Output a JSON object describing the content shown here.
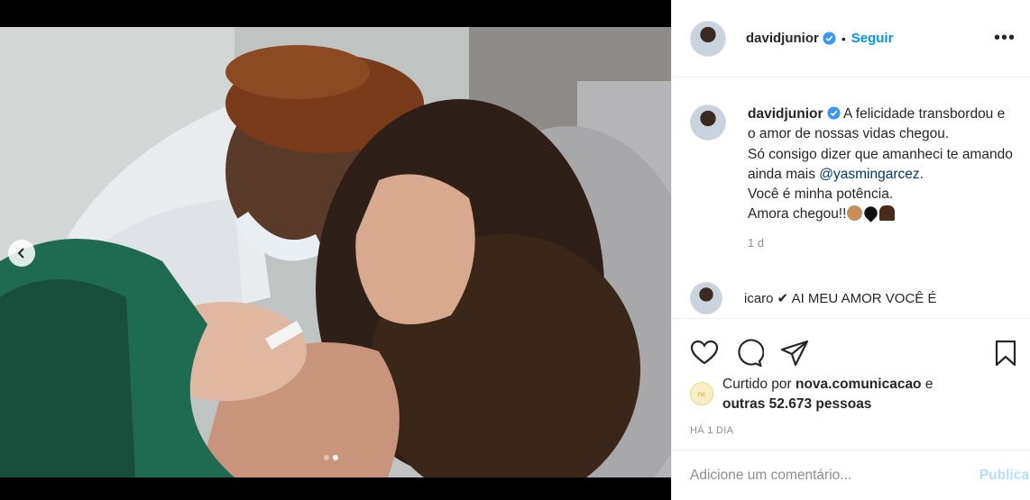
{
  "post": {
    "username": "davidjunior",
    "follow_label": "Seguir",
    "separator": "•",
    "more_label": "•••"
  },
  "caption": {
    "username": "davidjunior",
    "line1": "A felicidade transbordou e o amor de nossas vidas chegou.",
    "line2a": "Só consigo dizer que amanheci te amando ainda mais ",
    "mention": "@yasmingarcez",
    "line2b": ".",
    "line3": "Você é minha potência.",
    "line4": "Amora chegou!!",
    "time_ago": "1 d"
  },
  "next_comment": {
    "text": "icaro ✔ AI MEU AMOR VOCÊ É"
  },
  "likes": {
    "avatar_label": "nc",
    "prefix": "Curtido por ",
    "liker": "nova.comunicacao",
    "middle": " e",
    "others": "outras 52.673 pessoas"
  },
  "date_label": "HÁ 1 DIA",
  "comment_box": {
    "placeholder": "Adicione um comentário...",
    "publish_label": "Publicar"
  },
  "carousel": {
    "current": 2,
    "total": 2
  },
  "icons": [
    "chevron-left-icon",
    "verified-icon",
    "more-icon",
    "heart-icon",
    "comment-icon",
    "share-icon",
    "bookmark-icon"
  ],
  "colors": {
    "accent": "#0095f6",
    "verified": "#3897f0",
    "text": "#262626",
    "muted": "#8e8e8e",
    "publish_disabled": "#b2dffc"
  }
}
